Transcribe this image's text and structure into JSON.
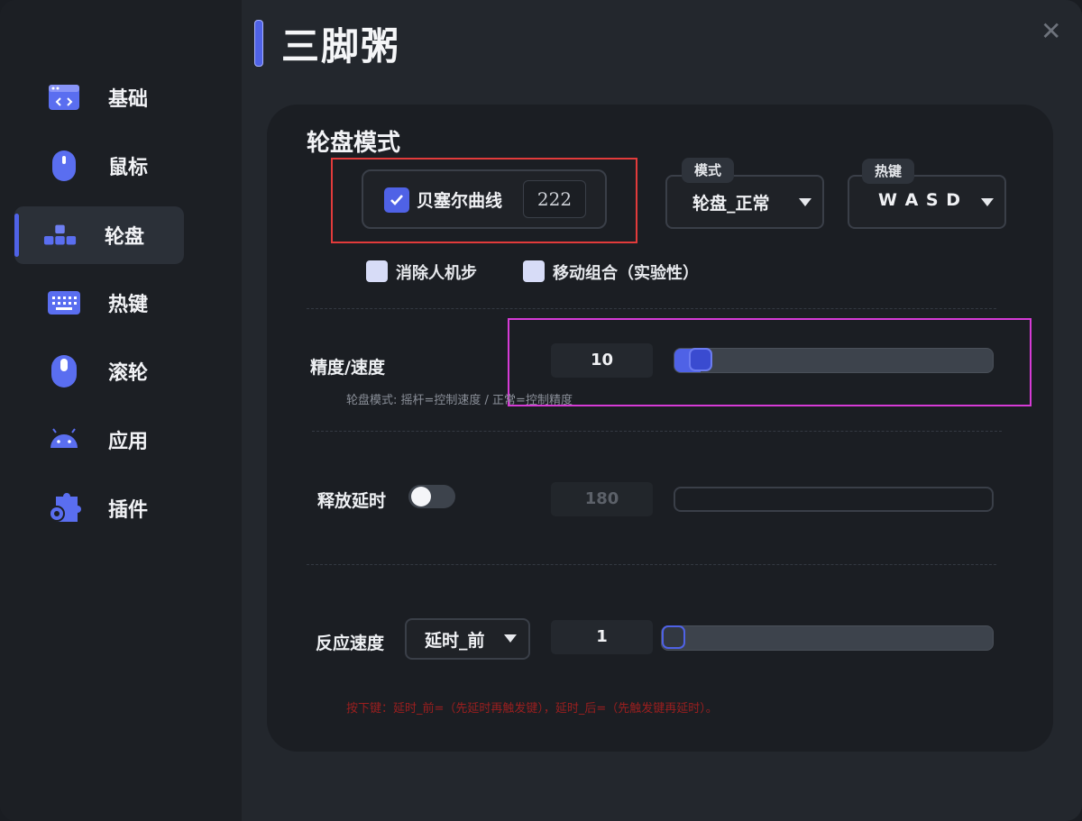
{
  "app": {
    "title": "三脚粥"
  },
  "sidebar": {
    "items": [
      {
        "label": "基础",
        "icon": "code-window-icon"
      },
      {
        "label": "鼠标",
        "icon": "mouse-icon"
      },
      {
        "label": "轮盘",
        "icon": "blocks-icon",
        "active": true
      },
      {
        "label": "热键",
        "icon": "keyboard-icon"
      },
      {
        "label": "滚轮",
        "icon": "mouse-wheel-icon"
      },
      {
        "label": "应用",
        "icon": "android-icon"
      },
      {
        "label": "插件",
        "icon": "plugin-gear-icon"
      }
    ]
  },
  "panel": {
    "section_title": "轮盘模式",
    "bezier": {
      "label": "贝塞尔曲线",
      "checked": true,
      "value": "222"
    },
    "mode_select": {
      "tag": "模式",
      "value": "轮盘_正常"
    },
    "hotkey_select": {
      "tag": "热键",
      "value": "W A S D"
    },
    "options": [
      {
        "label": "消除人机步",
        "checked": false
      },
      {
        "label": "移动组合（实验性）",
        "checked": false
      }
    ],
    "precision": {
      "label": "精度/速度",
      "value": "10",
      "slider_fraction": 0.05,
      "hint": "轮盘模式: 摇杆=控制速度 / 正常=控制精度"
    },
    "release_delay": {
      "label": "释放延时",
      "toggle_on": false,
      "value": "180"
    },
    "reaction_speed": {
      "label": "反应速度",
      "select_value": "延时_前",
      "value": "1",
      "slider_fraction": 0.0,
      "hint": "按下键：延时_前=（先延时再触发键），延时_后=（先触发键再延时）。"
    }
  },
  "colors": {
    "accent": "#4f62e6",
    "annotation_red": "#e23b3b",
    "annotation_magenta": "#d63bd6"
  }
}
